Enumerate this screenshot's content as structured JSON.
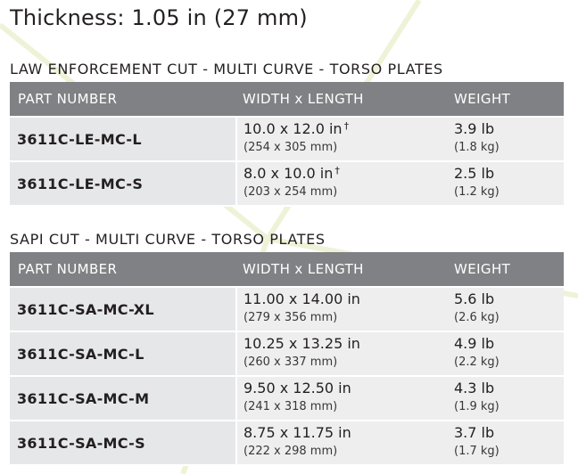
{
  "page_title": "Thickness: 1.05 in (27 mm)",
  "colors": {
    "header_bg": "#808184",
    "row_bg": "#e6e7e8",
    "text": "#231f20",
    "bg_lines": "#eef3d8"
  },
  "sections": [
    {
      "title": "LAW ENFORCEMENT CUT - MULTI CURVE - TORSO PLATES",
      "headers": {
        "part": "PART NUMBER",
        "dims": "WIDTH x LENGTH",
        "weight": "WEIGHT"
      },
      "rows": [
        {
          "part": "3611C-LE-MC-L",
          "dims_in": "10.0 x 12.0 in",
          "dagger": "†",
          "dims_mm": "(254 x 305 mm)",
          "weight_lb": "3.9 lb",
          "weight_kg": "(1.8 kg)"
        },
        {
          "part": "3611C-LE-MC-S",
          "dims_in": "8.0 x 10.0 in",
          "dagger": "†",
          "dims_mm": "(203 x 254 mm)",
          "weight_lb": "2.5 lb",
          "weight_kg": "(1.2 kg)"
        }
      ]
    },
    {
      "title": "SAPI CUT - MULTI CURVE - TORSO PLATES",
      "headers": {
        "part": "PART NUMBER",
        "dims": "WIDTH x LENGTH",
        "weight": "WEIGHT"
      },
      "rows": [
        {
          "part": "3611C-SA-MC-XL",
          "dims_in": "11.00 x 14.00 in",
          "dims_mm": "(279 x 356 mm)",
          "weight_lb": "5.6 lb",
          "weight_kg": "(2.6 kg)"
        },
        {
          "part": "3611C-SA-MC-L",
          "dims_in": "10.25 x 13.25 in",
          "dims_mm": "(260 x 337 mm)",
          "weight_lb": "4.9 lb",
          "weight_kg": "(2.2 kg)"
        },
        {
          "part": "3611C-SA-MC-M",
          "dims_in": "9.50 x 12.50 in",
          "dims_mm": "(241 x 318 mm)",
          "weight_lb": "4.3 lb",
          "weight_kg": "(1.9 kg)"
        },
        {
          "part": "3611C-SA-MC-S",
          "dims_in": "8.75 x 11.75 in",
          "dims_mm": "(222 x 298 mm)",
          "weight_lb": "3.7 lb",
          "weight_kg": "(1.7 kg)"
        }
      ]
    }
  ]
}
